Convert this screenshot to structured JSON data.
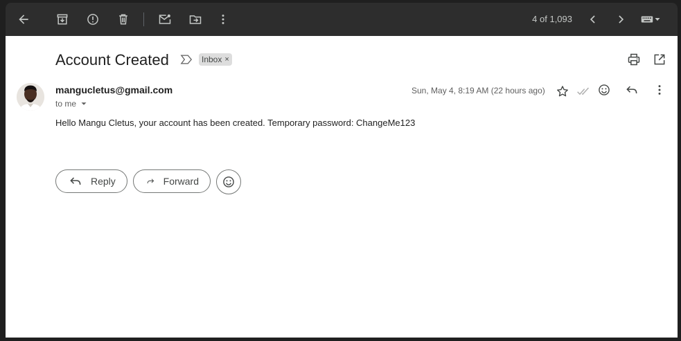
{
  "toolbar": {
    "count_text": "4 of 1,093"
  },
  "message": {
    "subject": "Account Created",
    "label": "Inbox",
    "label_remove": "×",
    "sender_email": "mangucletus@gmail.com",
    "recipient": "to me",
    "date": "Sun, May 4, 8:19 AM (22 hours ago)",
    "body": "Hello Mangu Cletus, your account has been created. Temporary password: ChangeMe123"
  },
  "actions": {
    "reply_label": "Reply",
    "forward_label": "Forward"
  },
  "colors": {
    "toolbar_bg": "#2d2d2d",
    "page_bg": "#ffffff",
    "text": "#1f1f1f",
    "label_chip_bg": "#dddddd"
  }
}
